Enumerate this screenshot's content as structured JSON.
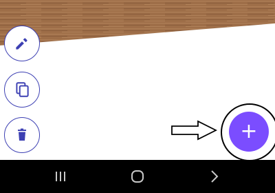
{
  "icons": {
    "edit": "pencil-icon",
    "copy": "copy-icon",
    "delete": "trash-icon",
    "add": "plus-icon",
    "annotation": "arrow-right-icon",
    "recent_apps": "recent-apps-icon",
    "home": "home-icon",
    "back": "back-chevron-icon"
  },
  "fab": {
    "label": "+"
  },
  "colors": {
    "accent_purple": "#7b4dff",
    "icon_blue": "#3d40b3",
    "nav_bar": "#000000",
    "nav_icon": "#c9c9c9",
    "wood": "#9b6b45"
  }
}
